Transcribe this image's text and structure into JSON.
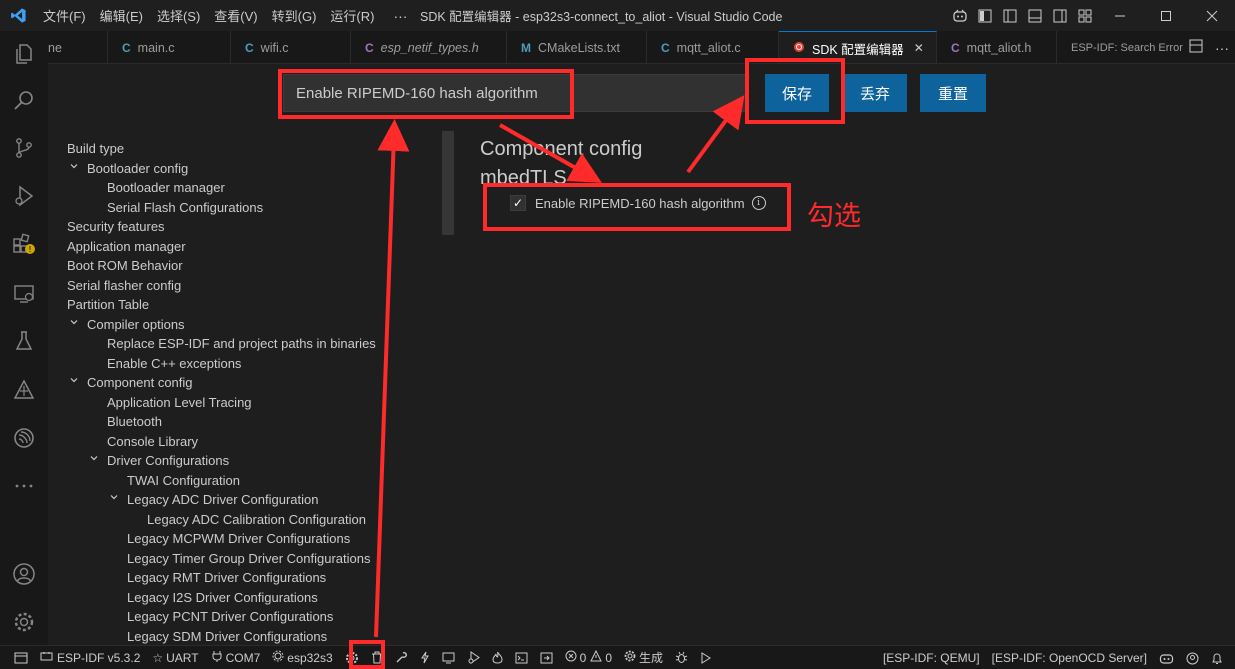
{
  "titlebar": {
    "menus": [
      "文件(F)",
      "编辑(E)",
      "选择(S)",
      "查看(V)",
      "转到(G)",
      "运行(R)"
    ],
    "more": "···",
    "title": "SDK 配置编辑器 - esp32s3-connect_to_aliot - Visual Studio Code"
  },
  "tabs": [
    {
      "icon": "",
      "label": "ne",
      "icon_color": "#519aba"
    },
    {
      "icon": "C",
      "label": "main.c",
      "icon_color": "#519aba"
    },
    {
      "icon": "C",
      "label": "wifi.c",
      "icon_color": "#519aba"
    },
    {
      "icon": "C",
      "label": "esp_netif_types.h",
      "icon_color": "#a074c4"
    },
    {
      "icon": "M",
      "label": "CMakeLists.txt",
      "icon_color": "#519aba"
    },
    {
      "icon": "C",
      "label": "mqtt_aliot.c",
      "icon_color": "#519aba"
    },
    {
      "icon": "",
      "label": "SDK 配置编辑器",
      "icon_color": "#e37933",
      "active": true,
      "close": "✕"
    },
    {
      "icon": "C",
      "label": "mqtt_aliot.h",
      "icon_color": "#a074c4"
    },
    {
      "icon": "",
      "label": "ESP-IDF: Search Error Hint",
      "icon_color": "#cccccc"
    }
  ],
  "editor": {
    "search_value": "Enable RIPEMD-160 hash algorithm",
    "save_label": "保存",
    "discard_label": "丢弃",
    "reset_label": "重置",
    "heading1": "Component config",
    "heading2": "mbedTLS",
    "setting_label": "Enable RIPEMD-160 hash algorithm",
    "setting_checked": true,
    "checkmark": "✓",
    "info": "i",
    "annotation": "勾选"
  },
  "tree": [
    {
      "label": "Build type",
      "level": 0,
      "chevron": false
    },
    {
      "label": "Bootloader config",
      "level": 0,
      "chevron": true
    },
    {
      "label": "Bootloader manager",
      "level": 1,
      "chevron": false
    },
    {
      "label": "Serial Flash Configurations",
      "level": 1,
      "chevron": false
    },
    {
      "label": "Security features",
      "level": 0,
      "chevron": false
    },
    {
      "label": "Application manager",
      "level": 0,
      "chevron": false
    },
    {
      "label": "Boot ROM Behavior",
      "level": 0,
      "chevron": false
    },
    {
      "label": "Serial flasher config",
      "level": 0,
      "chevron": false
    },
    {
      "label": "Partition Table",
      "level": 0,
      "chevron": false
    },
    {
      "label": "Compiler options",
      "level": 0,
      "chevron": true
    },
    {
      "label": "Replace ESP-IDF and project paths in binaries",
      "level": 1,
      "chevron": false
    },
    {
      "label": "Enable C++ exceptions",
      "level": 1,
      "chevron": false
    },
    {
      "label": "Component config",
      "level": 0,
      "chevron": true
    },
    {
      "label": "Application Level Tracing",
      "level": 1,
      "chevron": false
    },
    {
      "label": "Bluetooth",
      "level": 1,
      "chevron": false
    },
    {
      "label": "Console Library",
      "level": 1,
      "chevron": false
    },
    {
      "label": "Driver Configurations",
      "level": 1,
      "chevron": true
    },
    {
      "label": "TWAI Configuration",
      "level": 2,
      "chevron": false
    },
    {
      "label": "Legacy ADC Driver Configuration",
      "level": 2,
      "chevron": true
    },
    {
      "label": "Legacy ADC Calibration Configuration",
      "level": 3,
      "chevron": false
    },
    {
      "label": "Legacy MCPWM Driver Configurations",
      "level": 2,
      "chevron": false
    },
    {
      "label": "Legacy Timer Group Driver Configurations",
      "level": 2,
      "chevron": false
    },
    {
      "label": "Legacy RMT Driver Configurations",
      "level": 2,
      "chevron": false
    },
    {
      "label": "Legacy I2S Driver Configurations",
      "level": 2,
      "chevron": false
    },
    {
      "label": "Legacy PCNT Driver Configurations",
      "level": 2,
      "chevron": false
    },
    {
      "label": "Legacy SDM Driver Configurations",
      "level": 2,
      "chevron": false
    }
  ],
  "statusbar": {
    "idf_version": "ESP-IDF v5.3.2",
    "uart": "UART",
    "port": "COM7",
    "target": "esp32s3",
    "errors": "0",
    "warnings": "0",
    "build": "生成",
    "qemu": "[ESP-IDF: QEMU]",
    "openocd": "[ESP-IDF: OpenOCD Server]"
  },
  "colors": {
    "accent": "#0078d4",
    "button": "#0e639c",
    "annotation": "#ff2b2b"
  }
}
